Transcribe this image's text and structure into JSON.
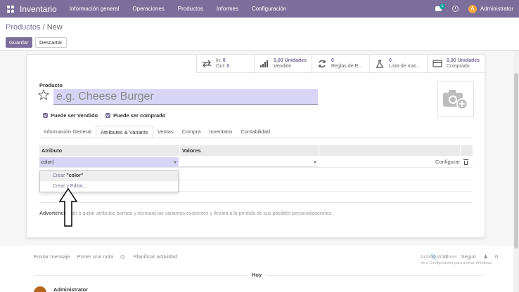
{
  "navbar": {
    "brand": "Inventario",
    "menu": [
      "Información general",
      "Operaciones",
      "Productos",
      "Informes",
      "Configuración"
    ],
    "chat_badge": "1",
    "avatar_letter": "A",
    "user": "Administrator"
  },
  "control": {
    "breadcrumb_parent": "Productos",
    "breadcrumb_current": "New",
    "save_label": "Guardar",
    "discard_label": "Descartar"
  },
  "smart_buttons": [
    {
      "icon": "arrows-exchange-icon",
      "line1_label": "In:",
      "line1_value": "0",
      "line2_label": "Out:",
      "line2_value": "0"
    },
    {
      "icon": "bar-chart-icon",
      "value": "0,00 Unidades",
      "label": "Vendido"
    },
    {
      "icon": "refresh-icon",
      "value": "0",
      "label": "Reglas de R..."
    },
    {
      "icon": "flask-icon",
      "value": "0",
      "label": "Lista de mat..."
    },
    {
      "icon": "credit-card-icon",
      "value": "0,00 Unidades",
      "label": "Comprado"
    }
  ],
  "product": {
    "label": "Producto",
    "name_placeholder": "e.g. Cheese Burger",
    "can_be_sold": "Puede ser Vendido",
    "can_be_purchased": "Puede ser comprado"
  },
  "tabs": [
    "Información General",
    "Attributes & Variants",
    "Ventas",
    "Compra",
    "Inventario",
    "Contabilidad"
  ],
  "active_tab": 1,
  "table": {
    "col_attribute": "Atributo",
    "col_values": "Valores",
    "row_attribute_value": "color",
    "configure_label": "Configurar"
  },
  "dropdown": {
    "create_prefix": "Crear ",
    "create_value": "\"color\"",
    "create_edit": "Crear y Editar..."
  },
  "warning": {
    "title": "Advertencia",
    "text": "adir o quitar atributos borrará y recreará las variantes existentes y llevará a la perdida de sus posibles personalizaciones."
  },
  "chatter": {
    "send_message": "Enviar mensaje",
    "log_note": "Poner una nota",
    "schedule_activity": "Planificar actividad",
    "attachments": "0",
    "follow": "Seguir",
    "followers": "0",
    "today": "Hoy",
    "author": "Administrator"
  },
  "watermark": {
    "line1": "Activar Windows",
    "line2": "Ve a Configuración para activar Windows."
  }
}
